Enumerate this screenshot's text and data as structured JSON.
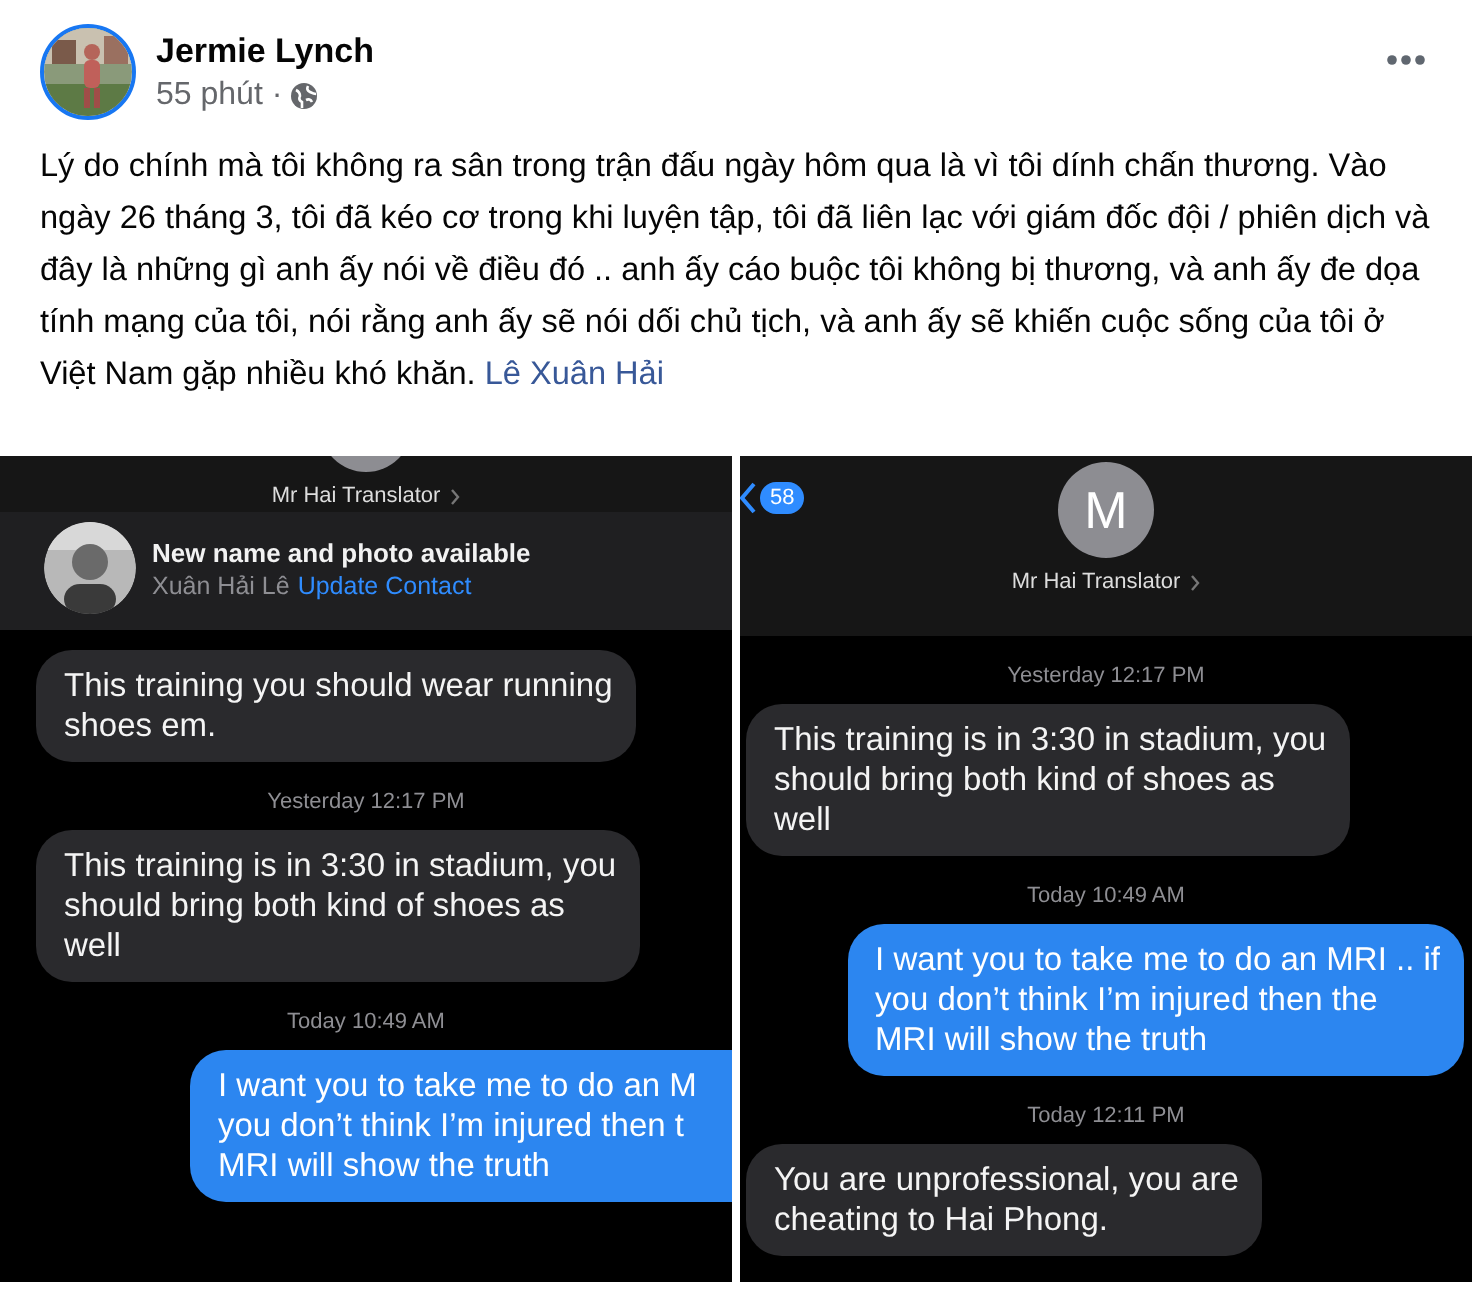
{
  "post": {
    "author": "Jermie Lynch",
    "time": "55 phút ·",
    "body": "Lý do chính mà tôi không ra sân trong trận đấu ngày hôm qua là vì tôi dính chấn thương. Vào ngày 26 tháng 3, tôi đã kéo cơ trong khi luyện tập, tôi đã liên lạc với giám đốc đội / phiên dịch và đây là những gì anh ấy nói về điều đó .. anh ấy cáo buộc tôi không bị thương, và anh ấy đe dọa tính mạng của tôi, nói rằng anh ấy sẽ nói dối chủ tịch, và anh ấy sẽ khiến cuộc sống của tôi ở Việt Nam gặp nhiều khó khăn.",
    "tag_link": "Lê Xuân Hải"
  },
  "screenshots": [
    {
      "contact_name": "Mr Hai Translator",
      "banner": {
        "title": "New name and photo available",
        "name": "Xuân Hải Lê",
        "link": "Update Contact"
      },
      "messages": [
        {
          "kind": "received",
          "lines": [
            "This training you should wear running",
            "shoes em."
          ]
        },
        {
          "kind": "timestamp",
          "text": "Yesterday 12:17 PM"
        },
        {
          "kind": "received",
          "lines": [
            "This training is in 3:30 in stadium, you",
            "should bring both kind of shoes as",
            "well"
          ]
        },
        {
          "kind": "timestamp",
          "text": "Today 10:49 AM"
        },
        {
          "kind": "sent",
          "lines": [
            "I want you to take me to do an M",
            "you don’t think I’m injured then t",
            "MRI will show the truth"
          ]
        }
      ]
    },
    {
      "contact_name": "Mr Hai Translator",
      "unread_badge": "58",
      "avatar_initial": "M",
      "messages": [
        {
          "kind": "timestamp",
          "text": "Yesterday 12:17 PM"
        },
        {
          "kind": "received",
          "lines": [
            "This training is in 3:30 in stadium, you",
            "should bring both kind of shoes as",
            "well"
          ]
        },
        {
          "kind": "timestamp",
          "text": "Today 10:49 AM"
        },
        {
          "kind": "sent",
          "lines": [
            "I want you to take me to do an MRI .. if",
            "you don’t think I’m injured then the",
            "MRI will show the truth"
          ]
        },
        {
          "kind": "timestamp",
          "text": "Today 12:11 PM"
        },
        {
          "kind": "received",
          "lines": [
            "You are unprofessional, you are",
            "cheating to Hai Phong."
          ]
        }
      ]
    }
  ]
}
